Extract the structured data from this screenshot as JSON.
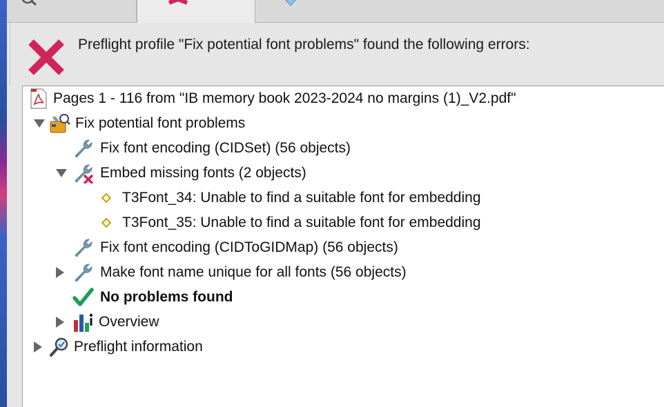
{
  "header": {
    "message": "Preflight profile \"Fix potential font problems\" found the following errors:"
  },
  "tree": {
    "file": "Pages 1 - 116 from \"IB memory book 2023-2024 no margins (1)_V2.pdf\"",
    "profile": "Fix potential font problems",
    "items": [
      {
        "label": "Fix font encoding (CIDSet) (56 objects)",
        "icon": "wrench-icon"
      },
      {
        "label": "Embed missing fonts (2 objects)",
        "icon": "wrench-error-icon",
        "expanded": true,
        "children": [
          {
            "label": "T3Font_34: Unable to find a suitable font for embedding",
            "icon": "diamond-icon"
          },
          {
            "label": "T3Font_35: Unable to find a suitable font for embedding",
            "icon": "diamond-icon"
          }
        ]
      },
      {
        "label": "Fix font encoding (CIDToGIDMap) (56 objects)",
        "icon": "wrench-icon"
      },
      {
        "label": "Make font name unique for all fonts (56 objects)",
        "icon": "wrench-icon",
        "expanded": false
      },
      {
        "label": "No problems found",
        "icon": "checkmark-icon",
        "bold": true
      },
      {
        "label": "Overview",
        "icon": "bar-chart-info-icon",
        "expanded": false
      }
    ],
    "preflight_info": "Preflight information"
  },
  "colors": {
    "error_red": "#d0245a",
    "check_green": "#1e9e5a",
    "wrench": "#7a9ab0",
    "diamond": "#d9b800"
  }
}
